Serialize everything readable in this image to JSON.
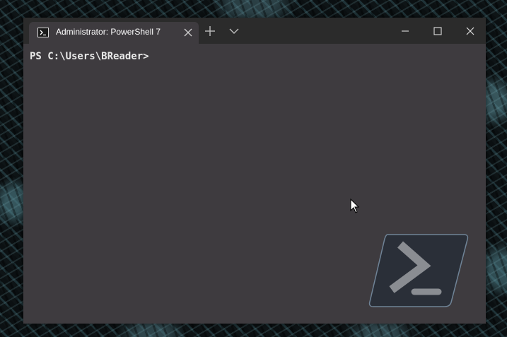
{
  "window": {
    "tab_title": "Administrator: PowerShell 7",
    "tab_icon": "powershell-icon",
    "close_tab_icon": "close-icon",
    "new_tab_icon": "plus-icon",
    "dropdown_icon": "chevron-down-icon",
    "minimize_icon": "minimize-icon",
    "maximize_icon": "maximize-icon",
    "close_window_icon": "close-icon"
  },
  "terminal": {
    "prompt": "PS C:\\Users\\BReader>"
  },
  "watermark": {
    "icon": "powershell-logo-icon"
  },
  "colors": {
    "terminal_bg": "#3e3b3f",
    "titlebar_bg": "#2b2b2b",
    "text": "#e8e8e8"
  }
}
